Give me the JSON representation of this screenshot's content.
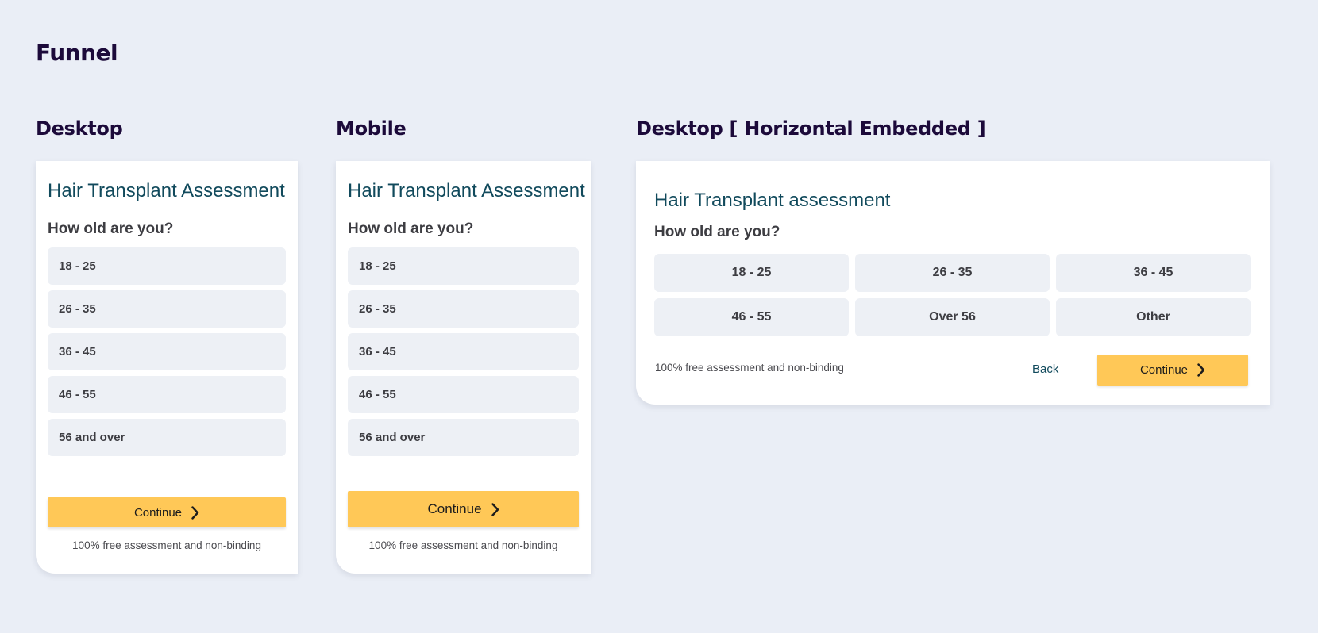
{
  "page": {
    "title": "Funnel"
  },
  "sections": {
    "desktop": "Desktop",
    "mobile": "Mobile",
    "horizontal": "Desktop [ Horizontal Embedded ]"
  },
  "desktop": {
    "form_title": "Hair Transplant Assessment",
    "question": "How old are you?",
    "options": [
      "18 - 25",
      "26 - 35",
      "36 - 45",
      "46 - 55",
      "56 and over"
    ],
    "continue_label": "Continue",
    "footnote": "100% free assessment and non-binding"
  },
  "mobile": {
    "form_title": "Hair Transplant Assessment",
    "question": "How old are you?",
    "options": [
      "18 - 25",
      "26 - 35",
      "36 - 45",
      "46 - 55",
      "56 and over"
    ],
    "continue_label": "Continue",
    "footnote": "100% free assessment and non-binding"
  },
  "horizontal": {
    "form_title": "Hair Transplant assessment",
    "question": "How old are you?",
    "options": [
      "18 - 25",
      "26 - 35",
      "36 - 45",
      "46 - 55",
      "Over 56",
      "Other"
    ],
    "footnote": "100% free assessment and non-binding",
    "back_label": "Back",
    "continue_label": "Continue"
  },
  "icons": {
    "continue": "chevron-right-icon"
  },
  "colors": {
    "background": "#eaeef6",
    "heading": "#1c0a3a",
    "form_title": "#114a5c",
    "option_bg": "#edf0f5",
    "accent": "#ffc857"
  }
}
